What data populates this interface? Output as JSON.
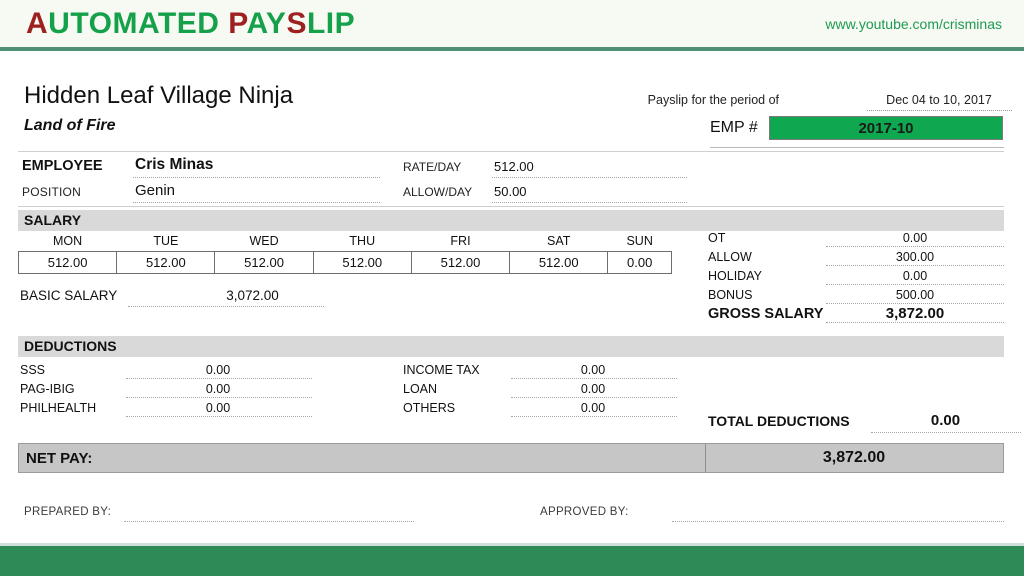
{
  "banner": {
    "title_parts": [
      {
        "text": "A",
        "color": "red"
      },
      {
        "text": "UTOMATED ",
        "color": "green"
      },
      {
        "text": "P",
        "color": "red"
      },
      {
        "text": "AY",
        "color": "green"
      },
      {
        "text": "S",
        "color": "red"
      },
      {
        "text": "LIP",
        "color": "green"
      }
    ],
    "title_full": "AUTOMATED PAYSLIP",
    "url": "www.youtube.com/crisminas",
    "green": "#15a14a",
    "red": "#9e2020",
    "url_color": "#1f9a52",
    "background": "#f7f9f3",
    "rule_color": "#4f8f76"
  },
  "footer_bar": {
    "color": "#2e8b57"
  },
  "header": {
    "company_name": "Hidden Leaf Village Ninja",
    "company_subtitle": "Land of Fire",
    "period_label": "Payslip for the period of",
    "period_value": "Dec 04 to 10, 2017",
    "emp_number_label": "EMP #",
    "emp_number_value": "2017-10",
    "emp_box_color": "#0fa750"
  },
  "employee": {
    "name_label": "EMPLOYEE",
    "name_value": "Cris Minas",
    "position_label": "POSITION",
    "position_value": "Genin",
    "rate_label": "RATE/DAY",
    "rate_value": "512.00",
    "allow_label": "ALLOW/DAY",
    "allow_value": "50.00"
  },
  "salary": {
    "band_title": "SALARY",
    "days": [
      "MON",
      "TUE",
      "WED",
      "THU",
      "FRI",
      "SAT",
      "SUN"
    ],
    "day_values": [
      "512.00",
      "512.00",
      "512.00",
      "512.00",
      "512.00",
      "512.00",
      "0.00"
    ],
    "basic_label": "BASIC SALARY",
    "basic_value": "3,072.00"
  },
  "summary": {
    "rows": [
      {
        "label": "OT",
        "value": "0.00"
      },
      {
        "label": "ALLOW",
        "value": "300.00"
      },
      {
        "label": "HOLIDAY",
        "value": "0.00"
      },
      {
        "label": "BONUS",
        "value": "500.00"
      }
    ],
    "gross_label": "GROSS SALARY",
    "gross_value": "3,872.00"
  },
  "deductions": {
    "band_title": "DEDUCTIONS",
    "left_rows": [
      {
        "label": "SSS",
        "value": "0.00"
      },
      {
        "label": "PAG-IBIG",
        "value": "0.00"
      },
      {
        "label": "PHILHEALTH",
        "value": "0.00"
      }
    ],
    "right_rows": [
      {
        "label": "INCOME TAX",
        "value": "0.00"
      },
      {
        "label": "LOAN",
        "value": "0.00"
      },
      {
        "label": "OTHERS",
        "value": "0.00"
      }
    ],
    "total_label": "TOTAL DEDUCTIONS",
    "total_value": "0.00"
  },
  "net_pay": {
    "label": "NET PAY:",
    "value": "3,872.00"
  },
  "signatures": {
    "prepared_by": "PREPARED BY:",
    "approved_by": "APPROVED BY:"
  }
}
